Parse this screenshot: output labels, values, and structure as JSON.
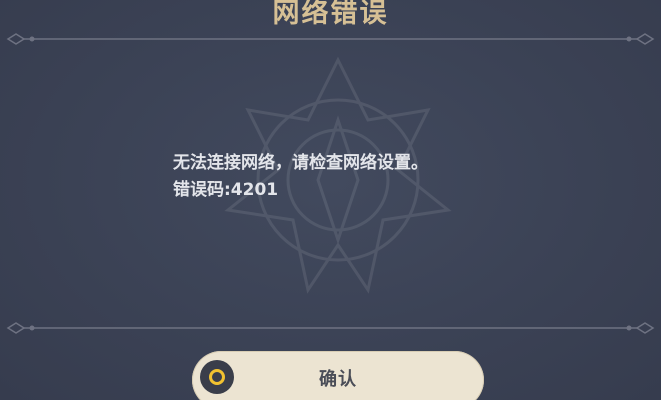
{
  "dialog": {
    "title": "网络错误",
    "message_line1": "无法连接网络，请检查网络设置。",
    "message_line2": "错误码:4201",
    "confirm_label": "确认"
  },
  "colors": {
    "background": "#3b4255",
    "title": "#d6c095",
    "divider": "#6e7282",
    "button_bg": "#ece4d2",
    "button_icon": "#f2c230"
  }
}
